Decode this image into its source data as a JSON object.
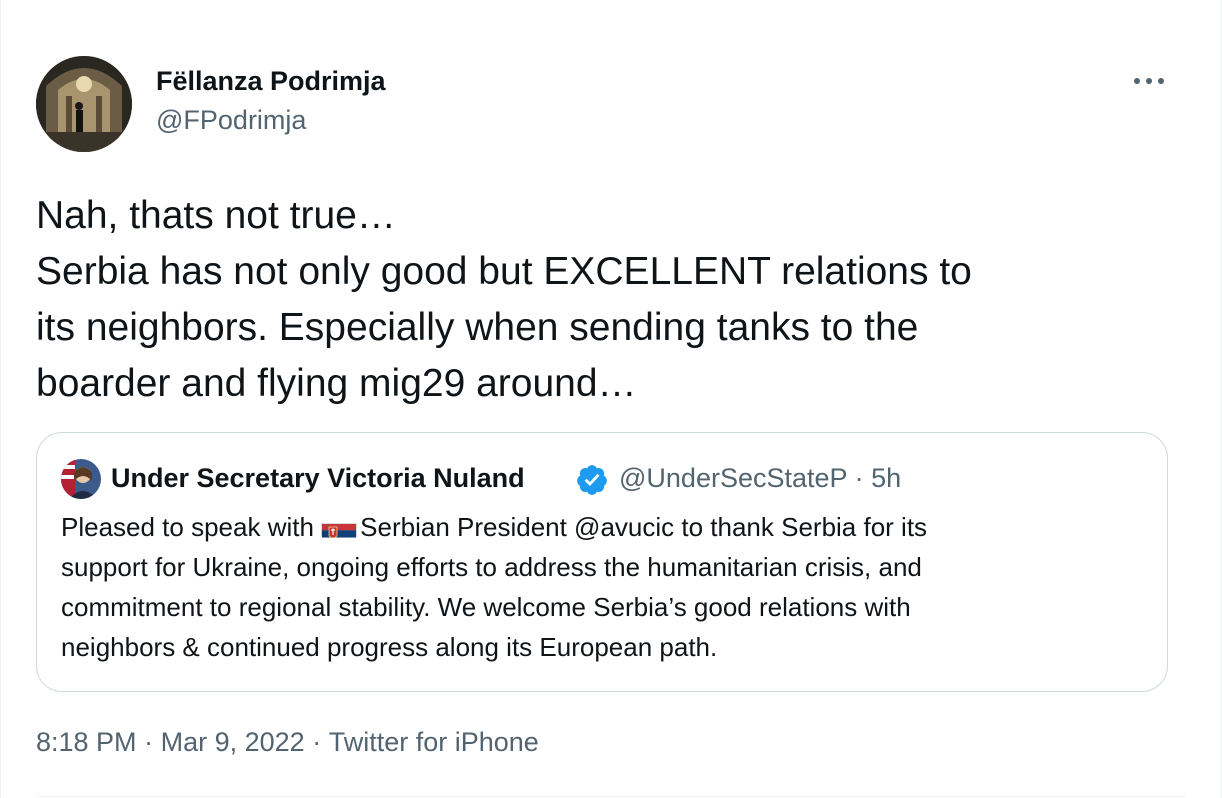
{
  "author": {
    "name": "Fëllanza Podrimja",
    "handle": "@FPodrimja"
  },
  "tweet": {
    "lines": [
      "Nah, thats not true…",
      "Serbia has not only good but EXCELLENT relations to",
      "its neighbors. Especially when sending tanks to the",
      "boarder and flying mig29 around…"
    ]
  },
  "quote": {
    "name": "Under Secretary Victoria Nuland",
    "handle": "@UnderSecStateP",
    "separator": "·",
    "age": "5h",
    "lines": [
      "Pleased to speak with ",
      "Serbian President @avucic to thank Serbia for its",
      "support for Ukraine, ongoing efforts to address the humanitarian crisis, and",
      "commitment to regional stability. We welcome Serbia’s good relations with",
      "neighbors & continued progress along its European path."
    ]
  },
  "meta": {
    "time": "8:18 PM",
    "date": "Mar 9, 2022",
    "source": "Twitter for iPhone",
    "separator": "·"
  },
  "colors": {
    "text": "#0f1419",
    "secondary": "#536471",
    "verified": "#1d9bf0",
    "border": "#cfd9de"
  },
  "icons": {
    "more": "more-horizontal-icon",
    "verified": "verified-badge-icon",
    "flag": "serbia-flag-icon"
  }
}
